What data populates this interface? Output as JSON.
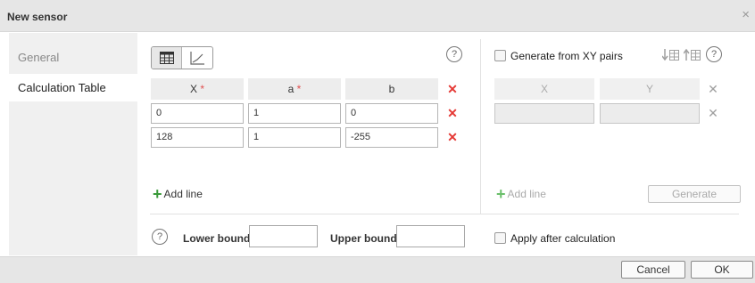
{
  "dialog": {
    "title": "New sensor",
    "close_symbol": "×"
  },
  "sidebar": {
    "items": [
      {
        "label": "General",
        "active": false
      },
      {
        "label": "Calculation Table",
        "active": true
      }
    ]
  },
  "calc_table": {
    "view_modes": [
      {
        "icon": "table-icon",
        "active": true
      },
      {
        "icon": "chart-icon",
        "active": false
      }
    ],
    "help_symbol": "?",
    "columns": [
      {
        "label": "X",
        "required": true
      },
      {
        "label": "a",
        "required": true
      },
      {
        "label": "b",
        "required": false
      }
    ],
    "required_mark": "*",
    "rows": [
      {
        "x": "0",
        "a": "1",
        "b": "0"
      },
      {
        "x": "128",
        "a": "1",
        "b": "-255"
      }
    ],
    "delete_symbol": "✕",
    "add_line_label": "Add line",
    "add_symbol": "+"
  },
  "xy_pairs": {
    "generate_label": "Generate from XY pairs",
    "checked": false,
    "columns": [
      "X",
      "Y"
    ],
    "add_line_label": "Add line",
    "generate_button": "Generate",
    "enabled": false
  },
  "bounds": {
    "help_symbol": "?",
    "lower_label": "Lower bound",
    "lower_value": "",
    "upper_label": "Upper bound",
    "upper_value": ""
  },
  "apply_after": {
    "label": "Apply after calculation",
    "checked": false
  },
  "footer": {
    "cancel_label": "Cancel",
    "ok_label": "OK"
  },
  "colors": {
    "delete": "#e53935",
    "add": "#3a9a3a",
    "required": "#e05050",
    "titlebar": "#e6e6e6"
  }
}
